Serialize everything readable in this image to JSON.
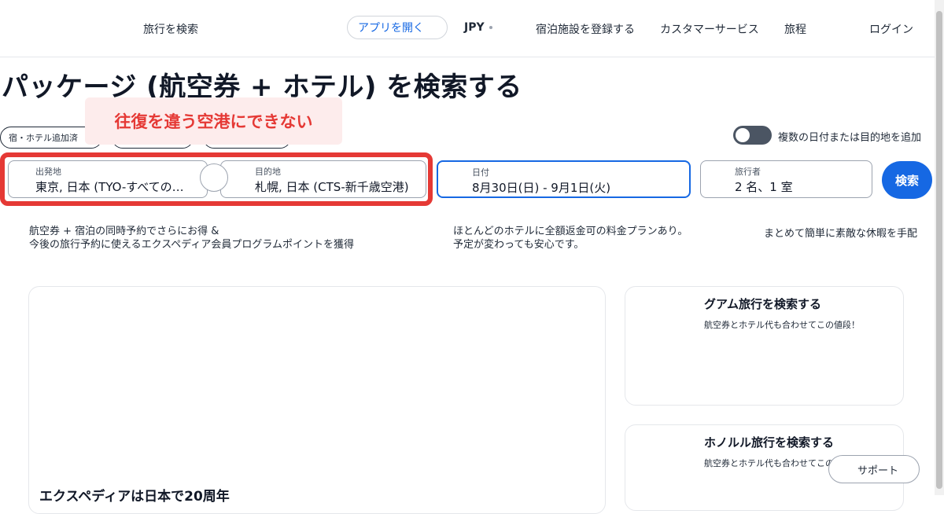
{
  "header": {
    "search_trips": "旅行を検索",
    "open_app": "アプリを開く",
    "currency": "JPY",
    "list_property": "宿泊施設を登録する",
    "customer_service": "カスタマーサービス",
    "trips": "旅程",
    "login": "ログイン"
  },
  "page": {
    "title": "パッケージ (航空券 + ホテル) を検索する"
  },
  "options": {
    "chip_hotel_added": "宿・ホテル追加済",
    "multi_toggle_label": "複数の日付または目的地を追加"
  },
  "annotation": {
    "callout_text": "往復を違う空港にできない"
  },
  "search_form": {
    "origin_label": "出発地",
    "origin_value": "東京, 日本 (TYO-すべての空港)",
    "destination_label": "目的地",
    "destination_value": "札幌, 日本 (CTS-新千歳空港)",
    "dates_label": "日付",
    "dates_value": "8月30日(日) - 9月1日(火)",
    "travelers_label": "旅行者",
    "travelers_value": "2 名、1 室",
    "search_button": "検索"
  },
  "benefits": {
    "b1_line1": "航空券 + 宿泊の同時予約でさらにお得 &",
    "b1_line2": "今後の旅行予約に使えるエクスペディア会員プログラムポイントを獲得",
    "b2_line1": "ほとんどのホテルに全額返金可の料金プランあり。",
    "b2_line2": "予定が変わっても安心です。",
    "b3_line1": "まとめて簡単に素敵な休暇を手配"
  },
  "cards": {
    "guam_title": "グアム旅行を検索する",
    "guam_sub": "航空券とホテル代も合わせてこの値段！",
    "honolulu_title": "ホノルル旅行を検索する",
    "honolulu_sub": "航空券とホテル代も合わせてこの値段！",
    "main_text": "エクスペディアは日本で20周年"
  },
  "support": {
    "label": "サポート"
  }
}
